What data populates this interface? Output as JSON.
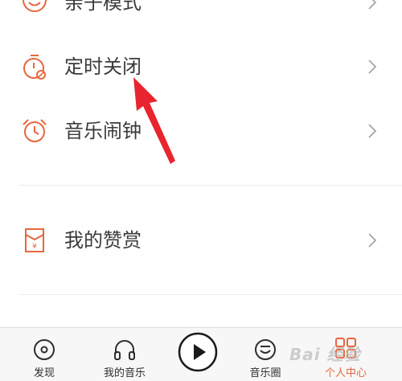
{
  "menu": {
    "items": [
      {
        "label": "亲子模式",
        "icon": "child-face-icon"
      },
      {
        "label": "定时关闭",
        "icon": "timer-off-icon"
      },
      {
        "label": "音乐闹钟",
        "icon": "alarm-clock-icon"
      },
      {
        "label": "我的赞赏",
        "icon": "red-envelope-icon"
      }
    ]
  },
  "tabbar": {
    "tabs": [
      {
        "label": "发现",
        "icon": "disc-icon",
        "active": false
      },
      {
        "label": "我的音乐",
        "icon": "headphones-icon",
        "active": false
      },
      {
        "label": "",
        "icon": "play-icon",
        "active": false
      },
      {
        "label": "音乐圈",
        "icon": "smile-circle-icon",
        "active": false
      },
      {
        "label": "个人中心",
        "icon": "grid-icon",
        "active": true
      }
    ]
  },
  "watermark": "Bai 经验",
  "colors": {
    "accent": "#e8663d",
    "text": "#3a3a3a",
    "arrow": "#e8242e"
  }
}
